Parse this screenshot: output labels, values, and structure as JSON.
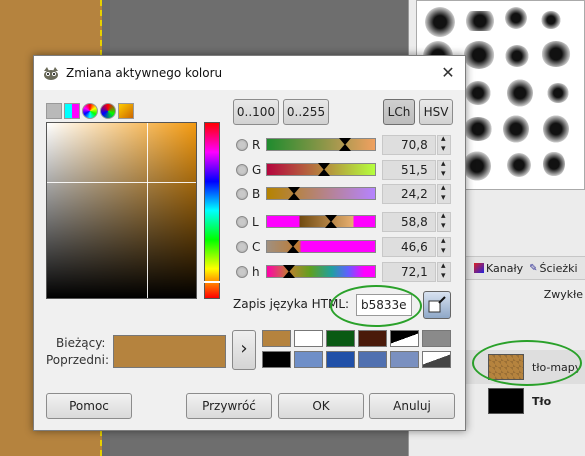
{
  "dialog": {
    "title": "Zmiana aktywnego koloru",
    "buttons_top": [
      "0..100",
      "0..255",
      "LCh",
      "HSV"
    ],
    "sliders": [
      {
        "label": "R",
        "value": "70,8",
        "fraction": 0.708,
        "gradient": [
          "#1f8b2e",
          "#f0a060"
        ]
      },
      {
        "label": "G",
        "value": "51,5",
        "fraction": 0.515,
        "gradient": [
          "#b5053e",
          "#b5ff3e"
        ]
      },
      {
        "label": "B",
        "value": "24,2",
        "fraction": 0.242,
        "gradient": [
          "#b58300",
          "#b583ff"
        ]
      },
      {
        "label": "L",
        "value": "58,8",
        "fraction": 0.588,
        "gradient": [
          "#ff00ff",
          "#ff00ff"
        ]
      },
      {
        "label": "C",
        "value": "46,6",
        "fraction": 0.233,
        "gradient": [
          "#a08060",
          "#ff00ff"
        ]
      },
      {
        "label": "h",
        "value": "72,1",
        "fraction": 0.2,
        "gradient": [
          "#ff00aa",
          "#ff00ff"
        ]
      }
    ],
    "html_label": "Zapis języka HTML:",
    "html_value": "b5833e",
    "current_label": "Bieżący:",
    "previous_label": "Poprzedni:",
    "current_color": "#b5833e",
    "history_colors": [
      "#b5833e",
      "#ffffff",
      "#0a5a14",
      "#4a1a0a",
      "#000000",
      "#8a8a8a",
      "#000000",
      "#6f8fc8",
      "#2050a8",
      "#5070b0",
      "#7a90c0",
      "#ffffff"
    ],
    "bottom_buttons": {
      "help": "Pomoc",
      "reset": "Przywróć",
      "ok": "OK",
      "cancel": "Anuluj"
    }
  },
  "panel": {
    "tab_channels": "Kanały",
    "tab_paths": "Ścieżki",
    "mode": "Zwykłe",
    "layers": [
      {
        "name": "tło-mapy",
        "thumb": "#b5833e"
      },
      {
        "name": "Tło",
        "thumb": "#000000"
      }
    ]
  },
  "colors": {
    "canvas": "#b5833e",
    "highlight": "#2aa12a"
  }
}
